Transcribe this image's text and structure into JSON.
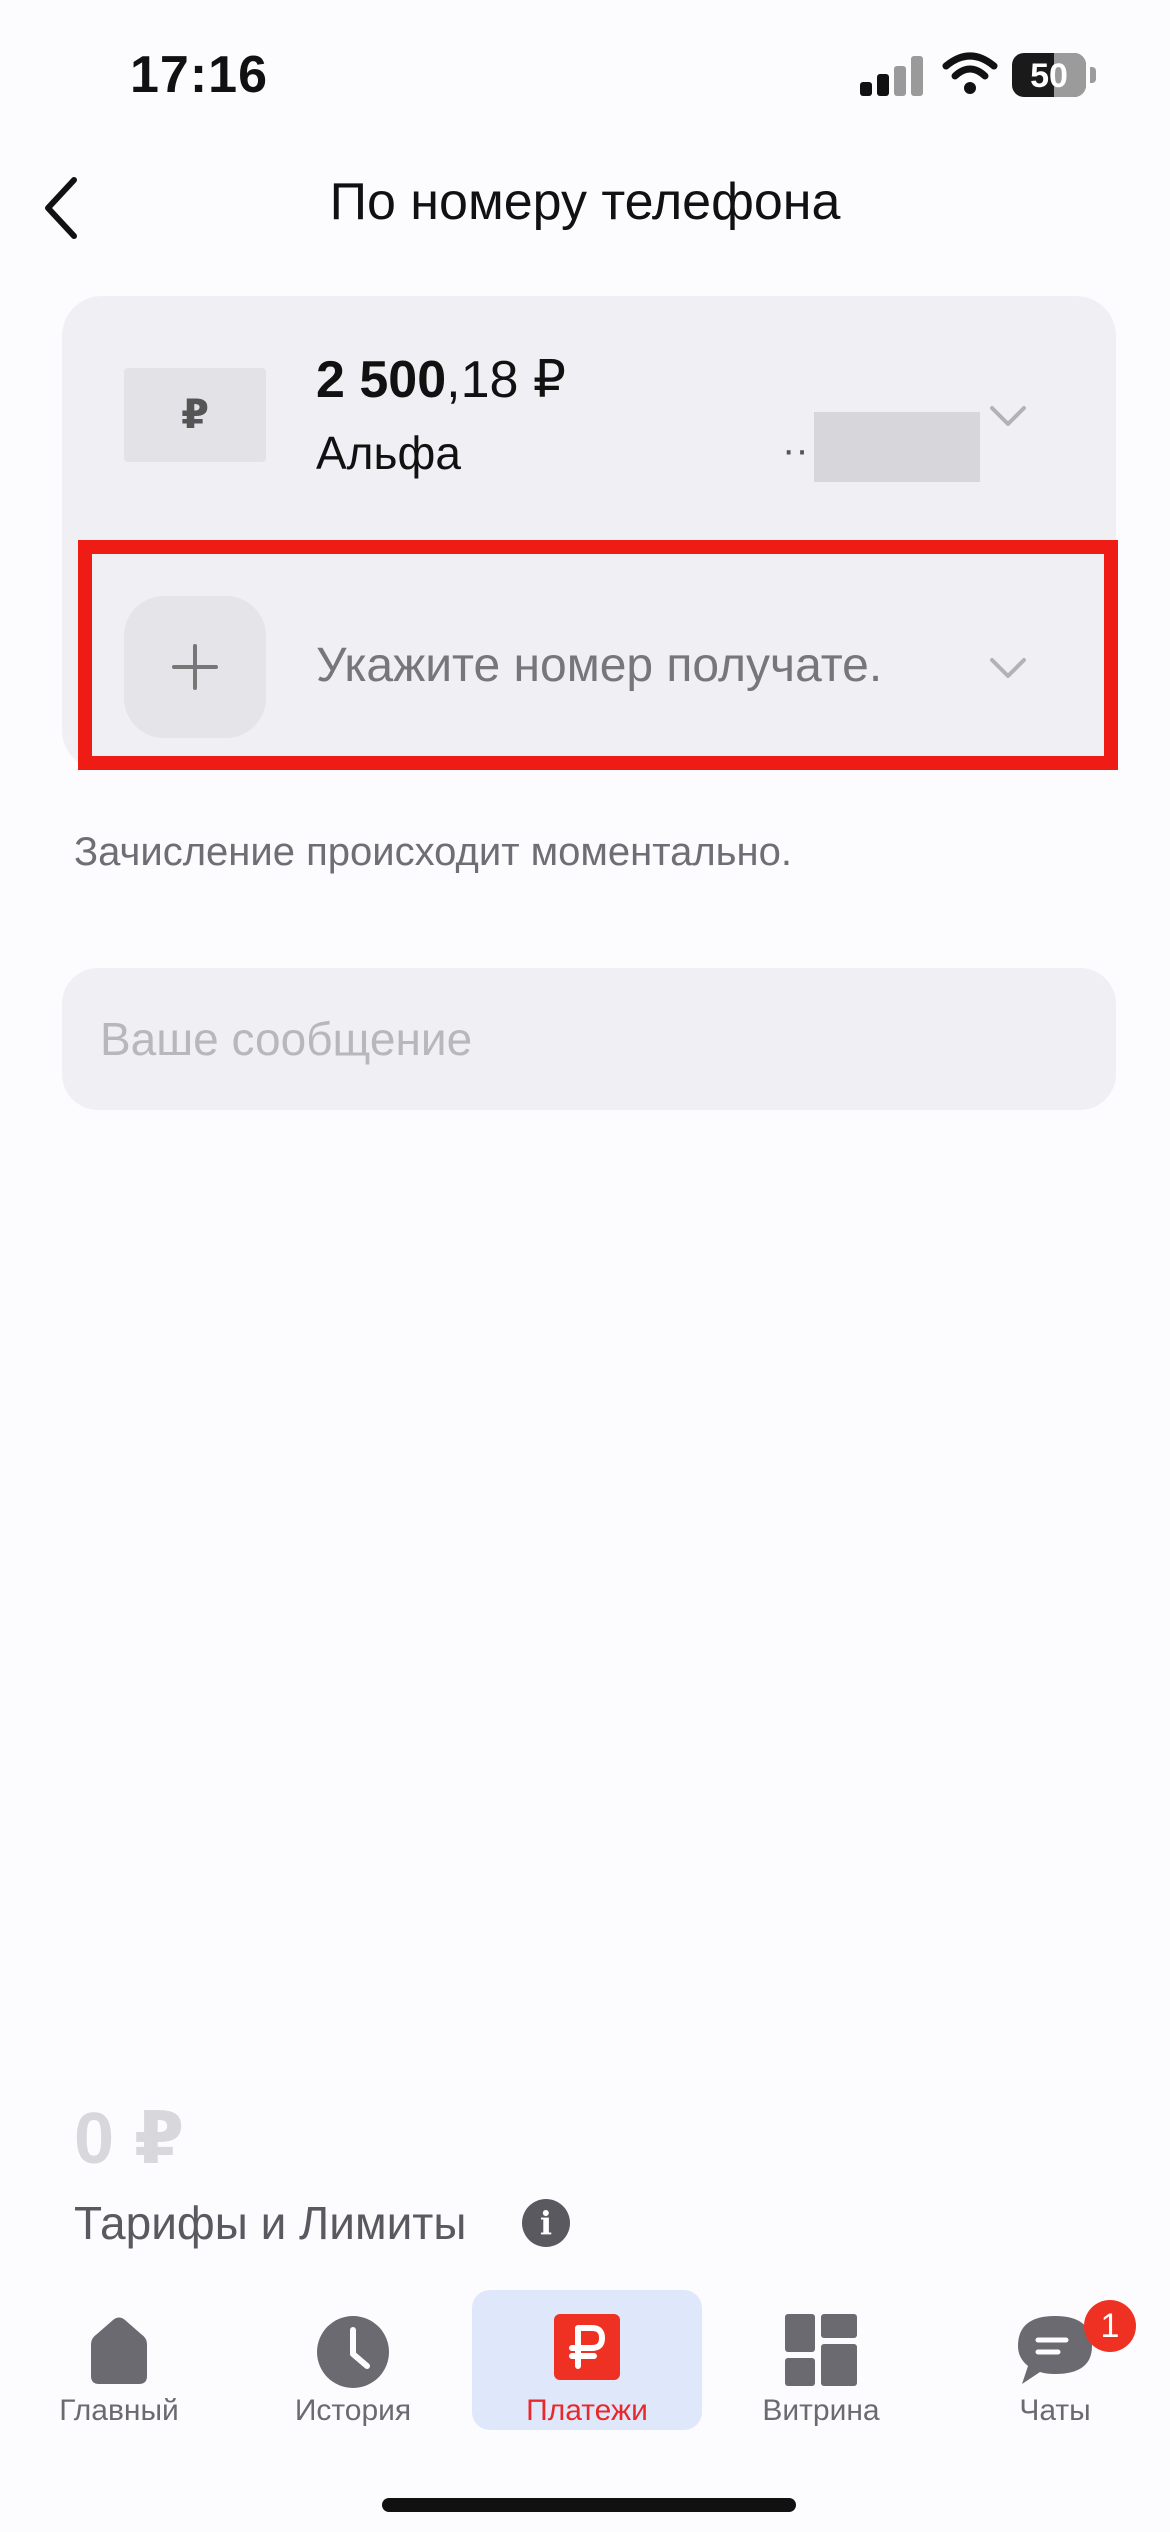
{
  "status_bar": {
    "time": "17:16",
    "battery": "50"
  },
  "header": {
    "title": "По номеру телефона"
  },
  "account": {
    "currency_symbol": "₽",
    "balance_main": "2 500",
    "balance_fraction": ",18 ₽",
    "name": "Альфа",
    "masked_number": "··"
  },
  "recipient": {
    "placeholder": "Укажите номер получате."
  },
  "note": "Зачисление происходит моментально.",
  "message": {
    "placeholder": "Ваше сообщение"
  },
  "summary": {
    "amount": "0 ₽",
    "tariffs_label": "Тарифы и Лимиты"
  },
  "tabs": [
    {
      "label": "Главный",
      "icon": "home-icon"
    },
    {
      "label": "История",
      "icon": "clock-icon"
    },
    {
      "label": "Платежи",
      "icon": "ruble-icon"
    },
    {
      "label": "Витрина",
      "icon": "grid-icon"
    },
    {
      "label": "Чаты",
      "icon": "chat-icon"
    }
  ],
  "active_tab": "Платежи",
  "chat_badge": "1",
  "colors": {
    "accent": "#ef3124",
    "highlight": "#ee1c14",
    "active_tab_bg": "#dfe8fb"
  }
}
